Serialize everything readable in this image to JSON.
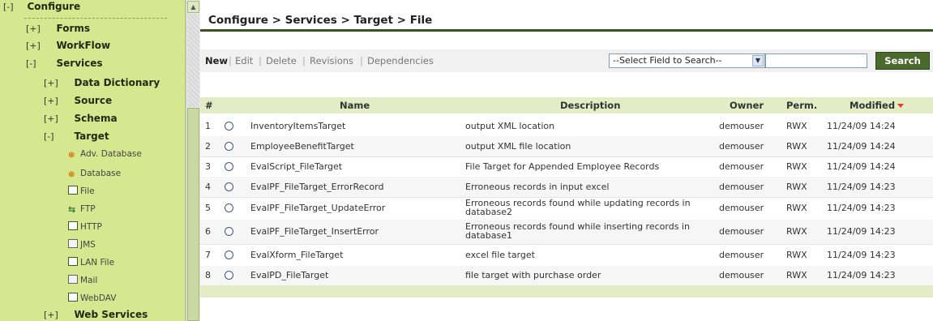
{
  "sidebar": {
    "root": {
      "toggle": "[-]",
      "label": "Configure"
    },
    "nodes": [
      {
        "toggle": "[+]",
        "label": "Forms"
      },
      {
        "toggle": "[+]",
        "label": "WorkFlow"
      },
      {
        "toggle": "[-]",
        "label": "Services"
      },
      {
        "toggle": "[+]",
        "label": "Data Dictionary"
      },
      {
        "toggle": "[+]",
        "label": "Source"
      },
      {
        "toggle": "[+]",
        "label": "Schema"
      },
      {
        "toggle": "[-]",
        "label": "Target"
      },
      {
        "toggle": "[+]",
        "label": "Web Services"
      }
    ],
    "leaves": [
      {
        "label": "Adv. Database",
        "icon": "database-icon"
      },
      {
        "label": "Database",
        "icon": "database-icon"
      },
      {
        "label": "File",
        "icon": "file-icon"
      },
      {
        "label": "FTP",
        "icon": "ftp-icon"
      },
      {
        "label": "HTTP",
        "icon": "http-icon"
      },
      {
        "label": "JMS",
        "icon": "mail-icon"
      },
      {
        "label": "LAN File",
        "icon": "file-icon"
      },
      {
        "label": "Mail",
        "icon": "mail-icon"
      },
      {
        "label": "WebDAV",
        "icon": "webdav-icon"
      }
    ]
  },
  "page": {
    "title": "Configure > Services > Target > File"
  },
  "actions": {
    "new": "New",
    "edit": "Edit",
    "delete": "Delete",
    "revisions": "Revisions",
    "dependencies": "Dependencies",
    "separator": "|"
  },
  "search": {
    "select_value": "--Select Field to Search--",
    "input_value": "",
    "button": "Search"
  },
  "table": {
    "headers": {
      "num": "#",
      "name": "Name",
      "description": "Description",
      "owner": "Owner",
      "perm": "Perm.",
      "modified": "Modified"
    },
    "rows": [
      {
        "num": "1",
        "name": "InventoryItemsTarget",
        "description": "output XML location",
        "owner": "demouser",
        "perm": "RWX",
        "modified": "11/24/09 14:24"
      },
      {
        "num": "2",
        "name": "EmployeeBenefitTarget",
        "description": "output XML file location",
        "owner": "demouser",
        "perm": "RWX",
        "modified": "11/24/09 14:24"
      },
      {
        "num": "3",
        "name": "EvalScript_FileTarget",
        "description": "File Target for Appended Employee Records",
        "owner": "demouser",
        "perm": "RWX",
        "modified": "11/24/09 14:24"
      },
      {
        "num": "4",
        "name": "EvalPF_FileTarget_ErrorRecord",
        "description": "Erroneous records in input excel",
        "owner": "demouser",
        "perm": "RWX",
        "modified": "11/24/09 14:23"
      },
      {
        "num": "5",
        "name": "EvalPF_FileTarget_UpdateError",
        "description": "Erroneous records found while updating records in database2",
        "owner": "demouser",
        "perm": "RWX",
        "modified": "11/24/09 14:23"
      },
      {
        "num": "6",
        "name": "EvalPF_FileTarget_InsertError",
        "description": "Erroneous records found while inserting records in database1",
        "owner": "demouser",
        "perm": "RWX",
        "modified": "11/24/09 14:23"
      },
      {
        "num": "7",
        "name": "EvalXform_FileTarget",
        "description": "excel file target",
        "owner": "demouser",
        "perm": "RWX",
        "modified": "11/24/09 14:23"
      },
      {
        "num": "8",
        "name": "EvalPD_FileTarget",
        "description": "file target with purchase order",
        "owner": "demouser",
        "perm": "RWX",
        "modified": "11/24/09 14:23"
      }
    ]
  },
  "colors": {
    "sidebar_bg": "#d6e88f",
    "accent_dark": "#3b5323",
    "button_bg": "#4a6a2c",
    "header_bg": "#e4ecc6",
    "sort_arrow": "#e04020"
  }
}
